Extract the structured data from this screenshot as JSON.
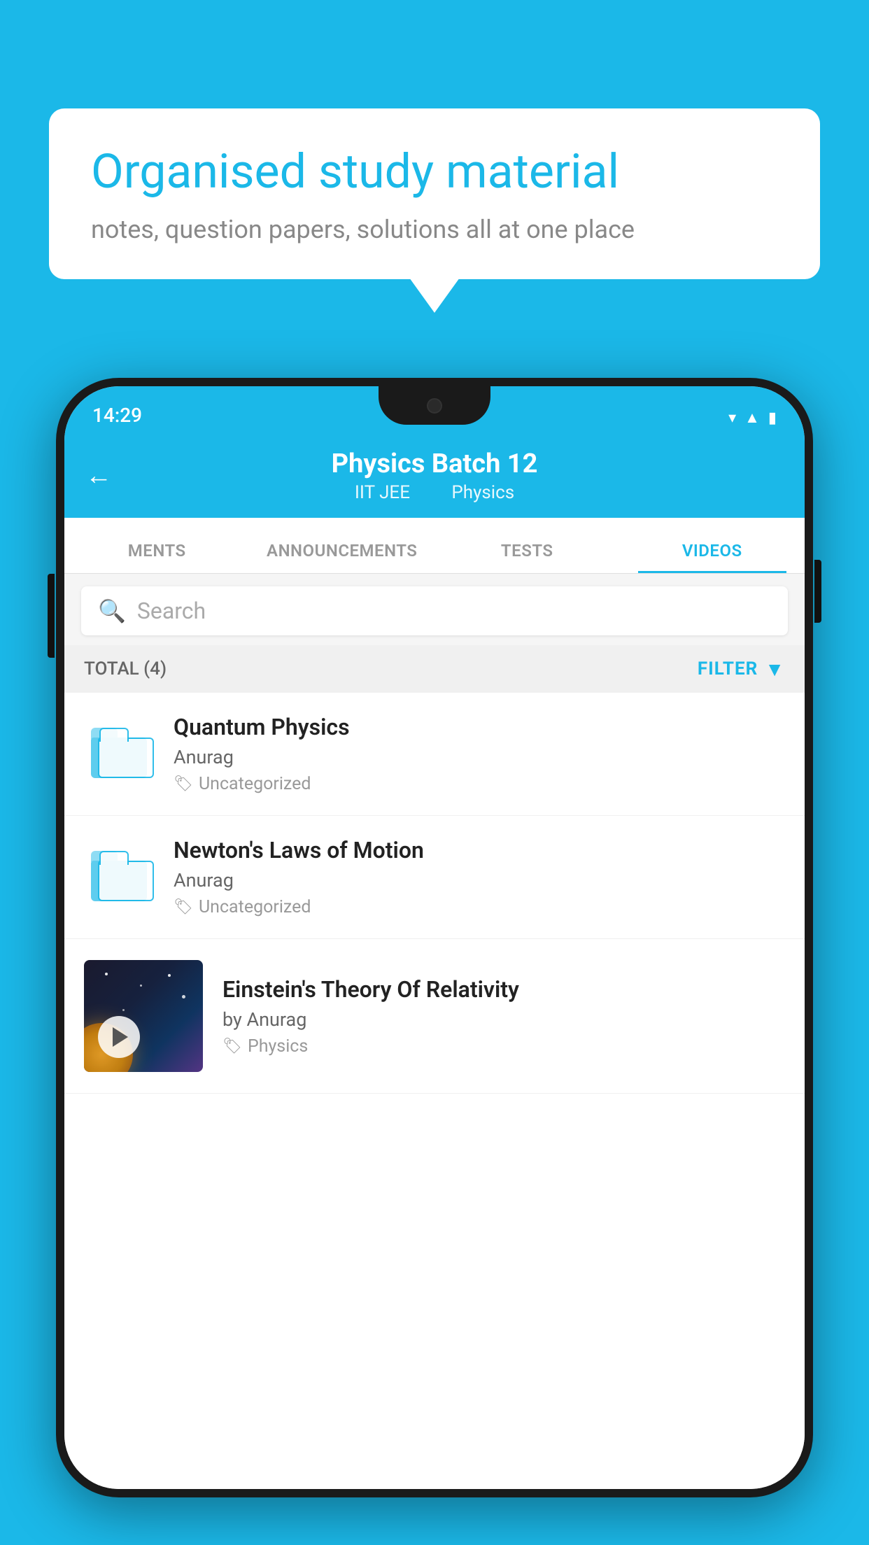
{
  "background_color": "#1BB8E8",
  "speech_bubble": {
    "title": "Organised study material",
    "subtitle": "notes, question papers, solutions all at one place"
  },
  "status_bar": {
    "time": "14:29",
    "icons": [
      "wifi",
      "signal",
      "battery"
    ]
  },
  "app_header": {
    "back_label": "←",
    "title": "Physics Batch 12",
    "subtitle_parts": [
      "IIT JEE",
      "Physics"
    ]
  },
  "tabs": [
    {
      "label": "MENTS",
      "active": false
    },
    {
      "label": "ANNOUNCEMENTS",
      "active": false
    },
    {
      "label": "TESTS",
      "active": false
    },
    {
      "label": "VIDEOS",
      "active": true
    }
  ],
  "search": {
    "placeholder": "Search"
  },
  "filter_bar": {
    "total_label": "TOTAL (4)",
    "filter_label": "FILTER"
  },
  "videos": [
    {
      "title": "Quantum Physics",
      "author": "Anurag",
      "tag": "Uncategorized",
      "has_thumb": false
    },
    {
      "title": "Newton's Laws of Motion",
      "author": "Anurag",
      "tag": "Uncategorized",
      "has_thumb": false
    },
    {
      "title": "Einstein's Theory Of Relativity",
      "author": "by Anurag",
      "tag": "Physics",
      "has_thumb": true
    }
  ]
}
